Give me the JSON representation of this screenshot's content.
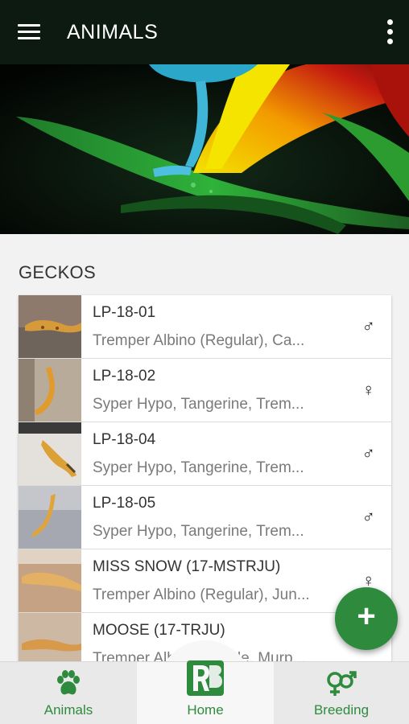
{
  "appbar": {
    "title": "ANIMALS",
    "menu_icon": "menu-icon",
    "overflow_icon": "more-vert-icon"
  },
  "section": {
    "title": "GECKOS"
  },
  "animals": [
    {
      "name": "LP-18-01",
      "genes": "Tremper Albino (Regular), Ca...",
      "sex": "♂",
      "sex_icon": "male-icon",
      "thumb_bg": "#8a7466"
    },
    {
      "name": "LP-18-02",
      "genes": "Syper Hypo, Tangerine, Trem...",
      "sex": "♀",
      "sex_icon": "female-icon",
      "thumb_bg": "#b8a996"
    },
    {
      "name": "LP-18-04",
      "genes": "Syper Hypo, Tangerine, Trem...",
      "sex": "♂",
      "sex_icon": "male-icon",
      "thumb_bg": "#d9d4cc"
    },
    {
      "name": "LP-18-05",
      "genes": "Syper Hypo, Tangerine, Trem...",
      "sex": "♂",
      "sex_icon": "male-icon",
      "thumb_bg": "#a7a9b2"
    },
    {
      "name": "MISS SNOW (17-MSTRJU)",
      "genes": "Tremper Albino (Regular), Jun...",
      "sex": "♀",
      "sex_icon": "female-icon",
      "thumb_bg": "#c9a98c"
    },
    {
      "name": "MOOSE (17-TRJU)",
      "genes": "Tremper Albino, Jungle, Murp...",
      "sex": "♂",
      "sex_icon": "male-icon",
      "thumb_bg": "#c7b39f"
    }
  ],
  "fab": {
    "label": "+",
    "icon": "add-icon"
  },
  "bottom_nav": [
    {
      "label": "Animals",
      "icon": "paw-icon"
    },
    {
      "label": "Home",
      "icon": "rb-logo-icon"
    },
    {
      "label": "Breeding",
      "icon": "breeding-sex-icon"
    }
  ],
  "colors": {
    "accent": "#2e8b3e",
    "appbar": "#0d1a12"
  }
}
